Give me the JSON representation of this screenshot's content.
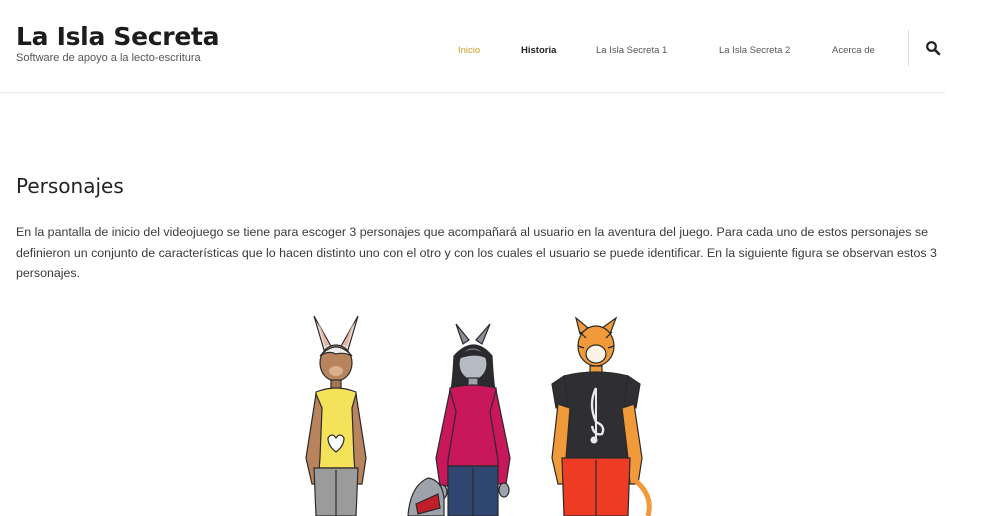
{
  "site": {
    "title": "La Isla Secreta",
    "description": "Software de apoyo a la lecto-escritura"
  },
  "nav": {
    "items": [
      {
        "label": "Inicio"
      },
      {
        "label": "Historia"
      },
      {
        "label": "La Isla Secreta 1"
      },
      {
        "label": "La Isla Secreta 2"
      },
      {
        "label": "Acerca de"
      }
    ],
    "search_icon": "search-icon"
  },
  "page": {
    "heading": "Personajes",
    "paragraph": "En la pantalla de inicio del videojuego se tiene para escoger 3 personajes que acompañará al usuario en la aventura del juego. Para cada uno de estos personajes se definieron un conjunto de características que lo hacen distinto uno con el otro y con los cuales el usuario se puede identificar. En la siguiente figura se observan estos 3 personajes."
  },
  "colors": {
    "accent": "#c9a227",
    "text": "#3a3a3a",
    "heading": "#222222"
  }
}
